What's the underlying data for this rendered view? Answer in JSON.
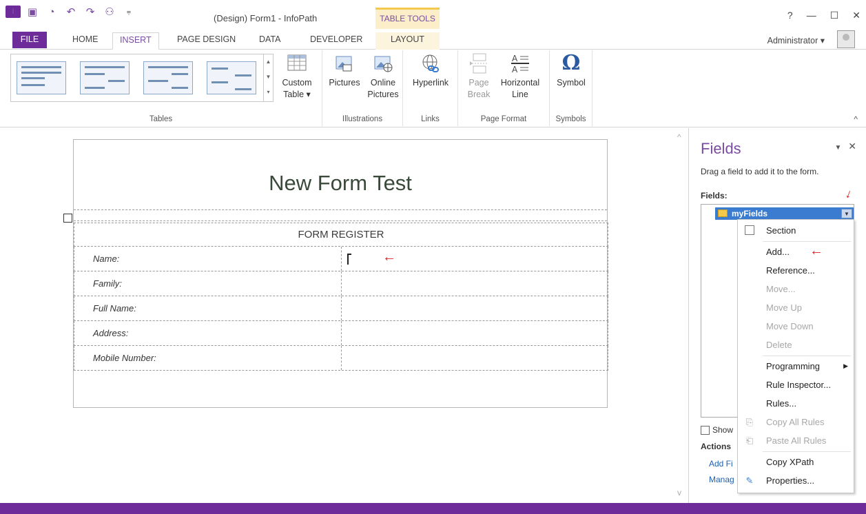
{
  "titlebar": {
    "doc_title": "(Design) Form1 - InfoPath",
    "context_tab": "TABLE TOOLS",
    "app_icon": "infopath-icon",
    "help": "?",
    "minimize": "—",
    "restore": "☐",
    "close": "✕"
  },
  "tabs": {
    "file": "FILE",
    "home": "HOME",
    "insert": "INSERT",
    "page_design": "PAGE DESIGN",
    "data": "DATA",
    "developer": "DEVELOPER",
    "layout": "LAYOUT"
  },
  "user": "Administrator ▾",
  "ribbon": {
    "tables_group": "Tables",
    "custom_table_1": "Custom",
    "custom_table_2": "Table ▾",
    "pictures": "Pictures",
    "online_pictures_1": "Online",
    "online_pictures_2": "Pictures",
    "illustrations_group": "Illustrations",
    "hyperlink": "Hyperlink",
    "links_group": "Links",
    "page_break_1": "Page",
    "page_break_2": "Break",
    "horizontal_line_1": "Horizontal",
    "horizontal_line_2": "Line",
    "page_format_group": "Page Format",
    "symbol": "Symbol",
    "symbols_group": "Symbols"
  },
  "form": {
    "title": "New Form Test",
    "table_header": "FORM REGISTER",
    "rows": [
      "Name:",
      "Family:",
      "Full Name:",
      "Address:",
      "Mobile Number:"
    ]
  },
  "pane": {
    "title": "Fields",
    "description": "Drag a field to add it to the form.",
    "fields_label": "Fields:",
    "root": "myFields",
    "show_label": "Show",
    "actions_label": "Actions",
    "link_add": "Add Fi",
    "link_manage": "Manag"
  },
  "menu": {
    "section": "Section",
    "add": "Add...",
    "reference": "Reference...",
    "move": "Move...",
    "move_up": "Move Up",
    "move_down": "Move Down",
    "delete": "Delete",
    "programming": "Programming",
    "rule_inspector": "Rule Inspector...",
    "rules": "Rules...",
    "copy_all_rules": "Copy All Rules",
    "paste_all_rules": "Paste All Rules",
    "copy_xpath": "Copy XPath",
    "properties": "Properties..."
  },
  "colors": {
    "accent": "#6e2c9a",
    "tree_selected": "#3b7bd0",
    "annotation_arrow": "#e02020"
  }
}
